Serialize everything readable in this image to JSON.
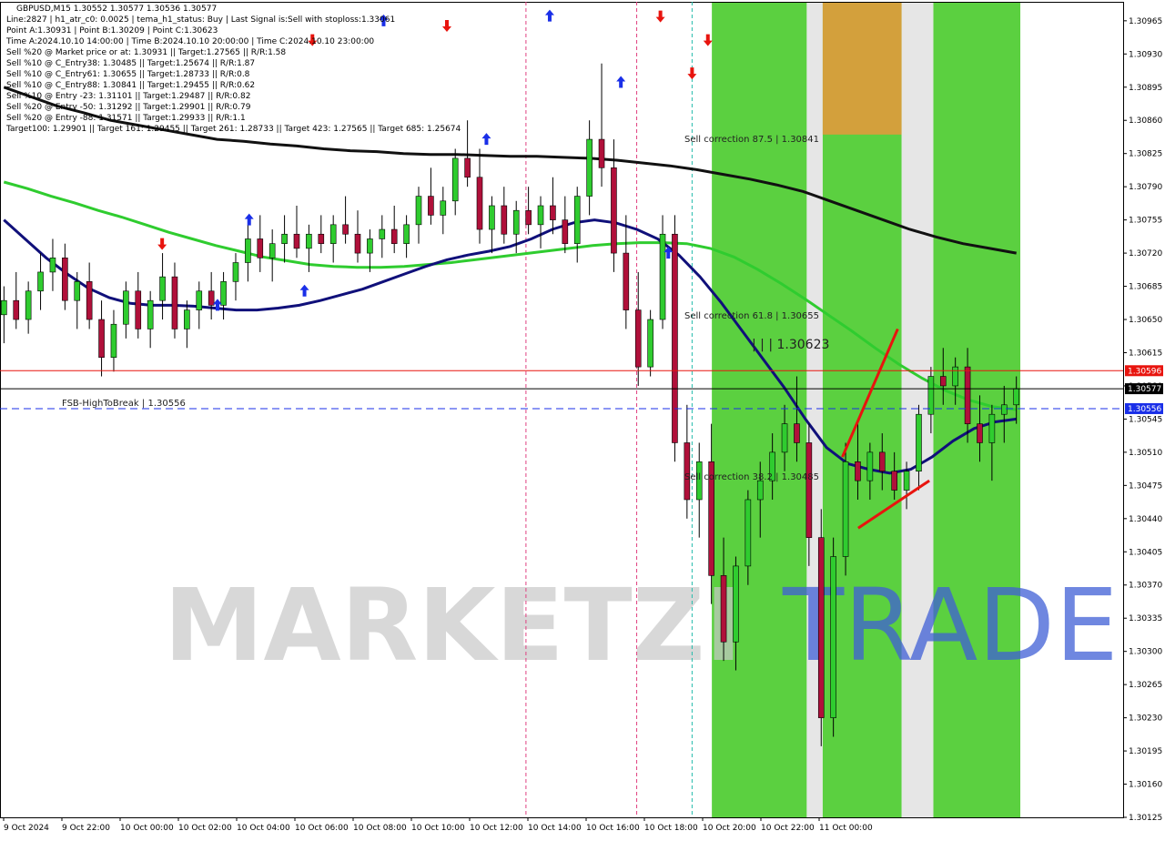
{
  "header": {
    "lines": [
      "GBPUSD,M15  1.30552 1.30577 1.30536 1.30577",
      "Line:2827  |  h1_atr_c0: 0.0025  |  tema_h1_status: Buy  |  Last Signal is:Sell with stoploss:1.33061",
      "Point A:1.30931  |  Point B:1.30209  |  Point C:1.30623",
      "Time A:2024.10.10 14:00:00  |  Time B:2024.10.10 20:00:00  |  Time C:2024.10.10 23:00:00",
      "Sell %20 @ Market price or at: 1.30931  ||  Target:1.27565  ||  R/R:1.58",
      "Sell %10 @ C_Entry38: 1.30485  ||  Target:1.25674  ||  R/R:1.87",
      "Sell %10 @ C_Entry61: 1.30655  ||  Target:1.28733  ||  R/R:0.8",
      "Sell %10 @ C_Entry88: 1.30841  ||  Target:1.29455  ||  R/R:0.62",
      "Sell %10 @ Entry -23: 1.31101  ||  Target:1.29487  ||  R/R:0.82",
      "Sell %20 @ Entry -50: 1.31292  ||  Target:1.29901  ||  R/R:0.79",
      "Sell %20 @ Entry -88: 1.31571  ||  Target:1.29933  ||  R/R:1.1",
      "Target100: 1.29901  ||  Target 161: 1.29455  ||  Target 261: 1.28733  ||  Target 423: 1.27565  ||  Target 685: 1.25674"
    ]
  },
  "watermark": {
    "part1": "MARKETZI",
    "part2": "TRADE"
  },
  "chart_data": {
    "type": "candlestick",
    "symbol": "GBPUSD",
    "timeframe": "M15",
    "ylim": [
      1.30125,
      1.30985
    ],
    "y_ticks": [
      "1.30965",
      "1.30930",
      "1.30895",
      "1.30860",
      "1.30825",
      "1.30790",
      "1.30755",
      "1.30720",
      "1.30685",
      "1.30650",
      "1.30615",
      "1.30580",
      "1.30545",
      "1.30510",
      "1.30475",
      "1.30440",
      "1.30405",
      "1.30370",
      "1.30335",
      "1.30300",
      "1.30265",
      "1.30230",
      "1.30195",
      "1.30160",
      "1.30125"
    ],
    "x_labels": [
      "9 Oct 2024",
      "9 Oct 22:00",
      "10 Oct 00:00",
      "10 Oct 02:00",
      "10 Oct 04:00",
      "10 Oct 06:00",
      "10 Oct 08:00",
      "10 Oct 10:00",
      "10 Oct 12:00",
      "10 Oct 14:00",
      "10 Oct 16:00",
      "10 Oct 18:00",
      "10 Oct 20:00",
      "10 Oct 22:00",
      "11 Oct 00:00"
    ],
    "price_tags": [
      {
        "value": 1.30596,
        "label": "1.30596",
        "color": "#e8140e"
      },
      {
        "value": 1.30577,
        "label": "1.30577",
        "color": "#000000"
      },
      {
        "value": 1.30556,
        "label": "1.30556",
        "color": "#1a2fe8"
      }
    ],
    "levels": [
      {
        "name": "FSB-HighToBreak",
        "value": 1.30556,
        "text": "FSB-HighToBreak | 1.30556"
      }
    ],
    "annotations": [
      {
        "text": "Sell correction 87.5 | 1.30841",
        "value": 1.30841
      },
      {
        "text": "Sell correction 61.8 | 1.30655",
        "value": 1.30655
      },
      {
        "text": "Sell correction 38.2 | 1.30485",
        "value": 1.30485
      },
      {
        "text": "| | | 1.30623",
        "value": 1.30623
      }
    ],
    "zones": [
      {
        "type": "green",
        "from_bar": 90,
        "to_bar": 101
      },
      {
        "type": "green",
        "from_bar": 104,
        "to_bar": 113
      },
      {
        "type": "green",
        "from_bar": 118,
        "to_bar": 128
      },
      {
        "type": "orange",
        "from_bar": 104,
        "to_bar": 113,
        "y_from": 1.30985,
        "y_to": 1.30845
      }
    ],
    "moving_averages": [
      {
        "color": "#111111",
        "values": [
          1.30895,
          1.30885,
          1.30875,
          1.30868,
          1.3086,
          1.30855,
          1.3085,
          1.30845,
          1.3084,
          1.30838,
          1.30835,
          1.30833,
          1.3083,
          1.30828,
          1.30827,
          1.30825,
          1.30824,
          1.30824,
          1.30823,
          1.30822,
          1.30822,
          1.30821,
          1.3082,
          1.30818,
          1.30815,
          1.30812,
          1.30808,
          1.30803,
          1.30798,
          1.30792,
          1.30785,
          1.30775,
          1.30765,
          1.30755,
          1.30745,
          1.30737,
          1.3073,
          1.30725,
          1.3072
        ]
      },
      {
        "color": "#2fcc2f",
        "values": [
          1.30795,
          1.30788,
          1.3078,
          1.30773,
          1.30765,
          1.30758,
          1.3075,
          1.30742,
          1.30735,
          1.30728,
          1.30722,
          1.30716,
          1.30712,
          1.30708,
          1.30706,
          1.30705,
          1.30705,
          1.30706,
          1.30708,
          1.3071,
          1.30713,
          1.30716,
          1.30719,
          1.30722,
          1.30725,
          1.30728,
          1.3073,
          1.30731,
          1.30731,
          1.3073,
          1.30725,
          1.30716,
          1.30703,
          1.30688,
          1.30672,
          1.30655,
          1.30638,
          1.3062,
          1.30603,
          1.30588,
          1.30575,
          1.30565,
          1.30558,
          1.30555
        ]
      },
      {
        "color": "#10107a",
        "values": [
          1.30755,
          1.30735,
          1.30715,
          1.30698,
          1.30683,
          1.30673,
          1.30667,
          1.30665,
          1.30665,
          1.30664,
          1.30662,
          1.3066,
          1.3066,
          1.30662,
          1.30665,
          1.3067,
          1.30676,
          1.30682,
          1.3069,
          1.30698,
          1.30706,
          1.30713,
          1.30718,
          1.30722,
          1.30727,
          1.30735,
          1.30745,
          1.30752,
          1.30755,
          1.30752,
          1.30745,
          1.30735,
          1.30718,
          1.30695,
          1.30668,
          1.30638,
          1.30608,
          1.30578,
          1.30545,
          1.30515,
          1.30498,
          1.30492,
          1.30488,
          1.30492,
          1.30505,
          1.30522,
          1.30535,
          1.30542,
          1.30545
        ]
      }
    ],
    "candles": [
      [
        1.30655,
        1.30685,
        1.30625,
        1.3067
      ],
      [
        1.3067,
        1.307,
        1.3064,
        1.3065
      ],
      [
        1.3065,
        1.3069,
        1.30635,
        1.3068
      ],
      [
        1.3068,
        1.3072,
        1.3066,
        1.307
      ],
      [
        1.307,
        1.30735,
        1.3068,
        1.30715
      ],
      [
        1.30715,
        1.3073,
        1.3066,
        1.3067
      ],
      [
        1.3067,
        1.307,
        1.3064,
        1.3069
      ],
      [
        1.3069,
        1.3071,
        1.3064,
        1.3065
      ],
      [
        1.3065,
        1.3067,
        1.3059,
        1.3061
      ],
      [
        1.3061,
        1.3066,
        1.30595,
        1.30645
      ],
      [
        1.30645,
        1.3069,
        1.3063,
        1.3068
      ],
      [
        1.3068,
        1.307,
        1.3063,
        1.3064
      ],
      [
        1.3064,
        1.3068,
        1.3062,
        1.3067
      ],
      [
        1.3067,
        1.3072,
        1.3065,
        1.30695
      ],
      [
        1.30695,
        1.3071,
        1.3063,
        1.3064
      ],
      [
        1.3064,
        1.3067,
        1.3062,
        1.3066
      ],
      [
        1.3066,
        1.3069,
        1.3064,
        1.3068
      ],
      [
        1.3068,
        1.307,
        1.3065,
        1.30665
      ],
      [
        1.30665,
        1.307,
        1.3065,
        1.3069
      ],
      [
        1.3069,
        1.3072,
        1.3067,
        1.3071
      ],
      [
        1.3071,
        1.3075,
        1.3069,
        1.30735
      ],
      [
        1.30735,
        1.3076,
        1.307,
        1.30715
      ],
      [
        1.30715,
        1.30745,
        1.3069,
        1.3073
      ],
      [
        1.3073,
        1.3076,
        1.3071,
        1.3074
      ],
      [
        1.3074,
        1.3077,
        1.30715,
        1.30725
      ],
      [
        1.30725,
        1.3075,
        1.307,
        1.3074
      ],
      [
        1.3074,
        1.3076,
        1.3072,
        1.3073
      ],
      [
        1.3073,
        1.3076,
        1.3071,
        1.3075
      ],
      [
        1.3075,
        1.3078,
        1.3073,
        1.3074
      ],
      [
        1.3074,
        1.30765,
        1.3071,
        1.3072
      ],
      [
        1.3072,
        1.30745,
        1.307,
        1.30735
      ],
      [
        1.30735,
        1.3076,
        1.30715,
        1.30745
      ],
      [
        1.30745,
        1.3077,
        1.3072,
        1.3073
      ],
      [
        1.3073,
        1.3076,
        1.30715,
        1.3075
      ],
      [
        1.3075,
        1.3079,
        1.3073,
        1.3078
      ],
      [
        1.3078,
        1.3081,
        1.3075,
        1.3076
      ],
      [
        1.3076,
        1.3079,
        1.3074,
        1.30775
      ],
      [
        1.30775,
        1.3083,
        1.3076,
        1.3082
      ],
      [
        1.3082,
        1.3086,
        1.3079,
        1.308
      ],
      [
        1.308,
        1.3083,
        1.3073,
        1.30745
      ],
      [
        1.30745,
        1.3078,
        1.3072,
        1.3077
      ],
      [
        1.3077,
        1.3079,
        1.3073,
        1.3074
      ],
      [
        1.3074,
        1.30775,
        1.3072,
        1.30765
      ],
      [
        1.30765,
        1.3079,
        1.3074,
        1.3075
      ],
      [
        1.3075,
        1.3078,
        1.30725,
        1.3077
      ],
      [
        1.3077,
        1.308,
        1.3074,
        1.30755
      ],
      [
        1.30755,
        1.3078,
        1.3072,
        1.3073
      ],
      [
        1.3073,
        1.3079,
        1.3071,
        1.3078
      ],
      [
        1.3078,
        1.3086,
        1.3076,
        1.3084
      ],
      [
        1.3084,
        1.3092,
        1.3079,
        1.3081
      ],
      [
        1.3081,
        1.3084,
        1.307,
        1.3072
      ],
      [
        1.3072,
        1.3076,
        1.3064,
        1.3066
      ],
      [
        1.3066,
        1.307,
        1.3058,
        1.306
      ],
      [
        1.306,
        1.3066,
        1.3059,
        1.3065
      ],
      [
        1.3065,
        1.3076,
        1.3064,
        1.3074
      ],
      [
        1.3074,
        1.3076,
        1.305,
        1.3052
      ],
      [
        1.3052,
        1.3056,
        1.3044,
        1.3046
      ],
      [
        1.3046,
        1.3052,
        1.3042,
        1.305
      ],
      [
        1.305,
        1.3054,
        1.3035,
        1.3038
      ],
      [
        1.3038,
        1.3042,
        1.3029,
        1.3031
      ],
      [
        1.3031,
        1.304,
        1.3028,
        1.3039
      ],
      [
        1.3039,
        1.3047,
        1.3037,
        1.3046
      ],
      [
        1.3046,
        1.305,
        1.3042,
        1.3048
      ],
      [
        1.3048,
        1.3053,
        1.3046,
        1.3051
      ],
      [
        1.3051,
        1.3056,
        1.3049,
        1.3054
      ],
      [
        1.3054,
        1.3059,
        1.305,
        1.3052
      ],
      [
        1.3052,
        1.3054,
        1.3039,
        1.3042
      ],
      [
        1.3042,
        1.3045,
        1.302,
        1.3023
      ],
      [
        1.3023,
        1.3042,
        1.3021,
        1.304
      ],
      [
        1.304,
        1.3052,
        1.3038,
        1.305
      ],
      [
        1.305,
        1.3054,
        1.3046,
        1.3048
      ],
      [
        1.3048,
        1.3052,
        1.3046,
        1.3051
      ],
      [
        1.3051,
        1.3053,
        1.3047,
        1.3049
      ],
      [
        1.3049,
        1.3051,
        1.3046,
        1.3047
      ],
      [
        1.3047,
        1.305,
        1.3045,
        1.3049
      ],
      [
        1.3049,
        1.3056,
        1.3047,
        1.3055
      ],
      [
        1.3055,
        1.306,
        1.3053,
        1.3059
      ],
      [
        1.3059,
        1.3062,
        1.3056,
        1.3058
      ],
      [
        1.3058,
        1.3061,
        1.3056,
        1.306
      ],
      [
        1.306,
        1.3062,
        1.3052,
        1.3054
      ],
      [
        1.3054,
        1.3057,
        1.305,
        1.3052
      ],
      [
        1.3052,
        1.3056,
        1.3048,
        1.3055
      ],
      [
        1.3055,
        1.3058,
        1.3052,
        1.3056
      ],
      [
        1.3056,
        1.3059,
        1.3054,
        1.30577
      ]
    ],
    "signals": [
      {
        "type": "down",
        "bar": 39,
        "value": 1.30945
      },
      {
        "type": "up",
        "bar": 48,
        "value": 1.30965
      },
      {
        "type": "down",
        "bar": 56,
        "value": 1.3096
      },
      {
        "type": "up",
        "bar": 69,
        "value": 1.3097
      },
      {
        "type": "down",
        "bar": 83,
        "value": 1.3097
      },
      {
        "type": "down",
        "bar": 89,
        "value": 1.30945
      },
      {
        "type": "up",
        "bar": 78,
        "value": 1.309
      },
      {
        "type": "down",
        "bar": 87,
        "value": 1.3091
      },
      {
        "type": "up",
        "bar": 84,
        "value": 1.3072
      },
      {
        "type": "up",
        "bar": 61,
        "value": 1.3084
      },
      {
        "type": "up",
        "bar": 31,
        "value": 1.30755
      },
      {
        "type": "up",
        "bar": 38,
        "value": 1.3068
      },
      {
        "type": "down",
        "bar": 20,
        "value": 1.3073
      },
      {
        "type": "up",
        "bar": 27,
        "value": 1.30665
      }
    ]
  }
}
